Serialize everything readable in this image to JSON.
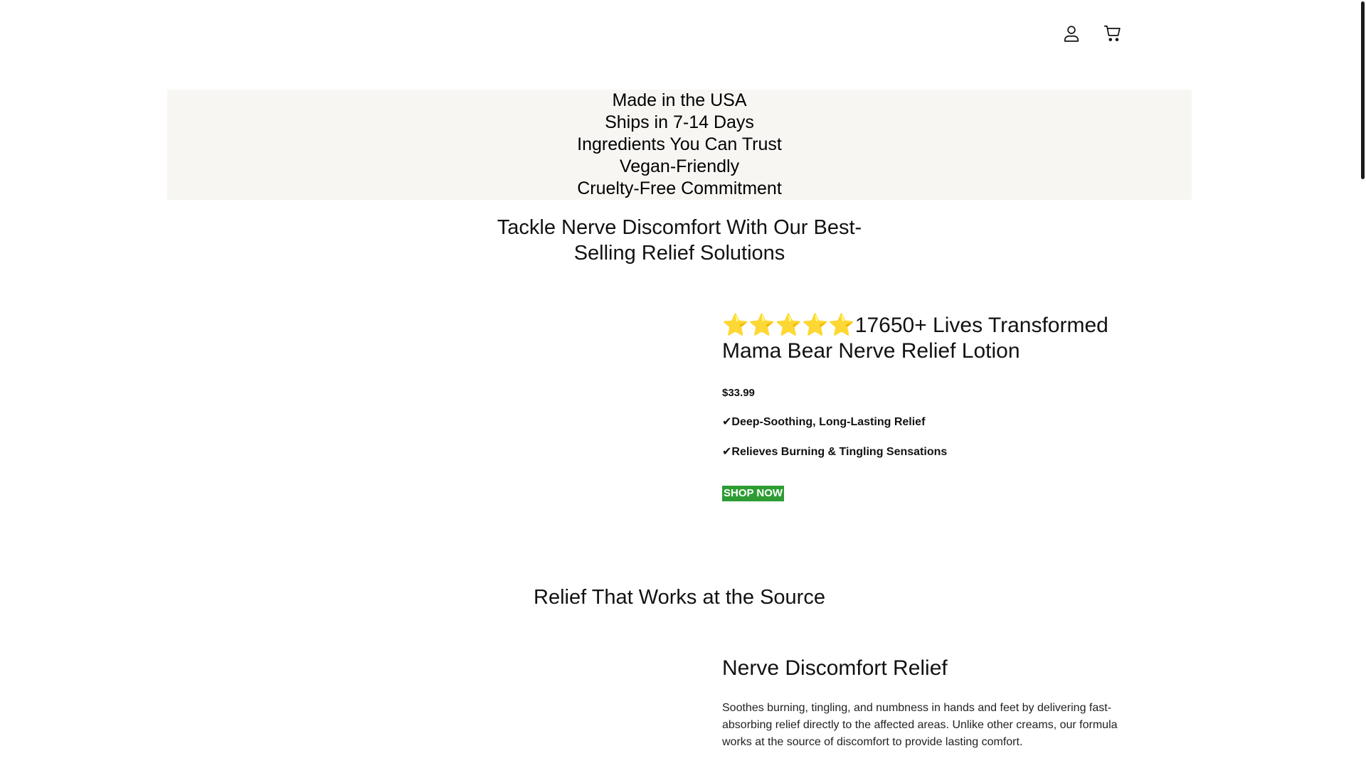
{
  "header": {
    "icons": [
      "account-icon",
      "cart-icon"
    ]
  },
  "trust_banner": {
    "items": [
      "Made in the USA",
      "Ships in 7-14 Days",
      "Ingredients You Can Trust",
      "Vegan-Friendly",
      "Cruelty-Free Commitment"
    ]
  },
  "hero": {
    "title_line1": "Tackle Nerve Discomfort With Our Best-",
    "title_line2": "Selling Relief Solutions"
  },
  "product": {
    "stars": "⭐⭐⭐⭐⭐",
    "rating_text": "17650+ Lives Transformed",
    "name": "Mama Bear Nerve Relief Lotion",
    "price": "$33.99",
    "features": [
      "✔Deep-Soothing, Long-Lasting Relief",
      "✔Relieves Burning & Tingling Sensations"
    ],
    "cta_label": "SHOP NOW"
  },
  "section2": {
    "title": "Relief That Works at the Source"
  },
  "benefit": {
    "title": "Nerve Discomfort Relief",
    "text": "Soothes burning, tingling, and numbness in hands and feet by delivering fast-absorbing relief directly to the affected areas. Unlike other creams, our formula works at the source of discomfort to provide lasting comfort."
  },
  "colors": {
    "banner_bg": "#f7f6f3",
    "cta_bg": "#2e9c34",
    "star": "#f4c20d"
  }
}
